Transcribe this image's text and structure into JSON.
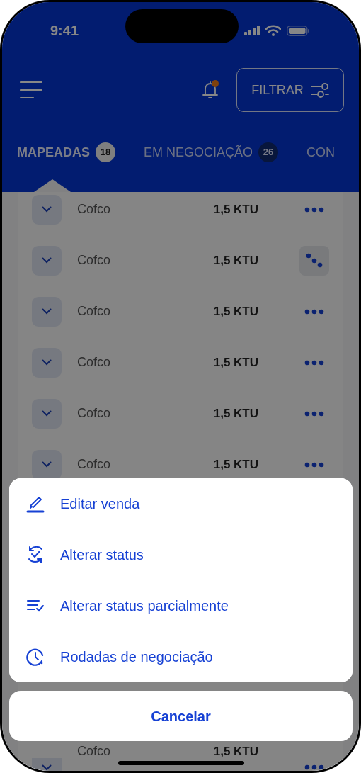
{
  "status_bar": {
    "time": "9:41"
  },
  "toolbar": {
    "notification_unread": true,
    "filter_button": "FILTRAR"
  },
  "tabs": [
    {
      "label": "MAPEADAS",
      "count": "18",
      "selected": true
    },
    {
      "label": "EM NEGOCIAÇÃO",
      "count": "26",
      "selected": false
    },
    {
      "label": "CON",
      "selected": false
    }
  ],
  "rows": [
    {
      "name": "Cofco",
      "amount": "1,5 KTU",
      "menu_open": false
    },
    {
      "name": "Cofco",
      "amount": "1,5 KTU",
      "menu_open": true
    },
    {
      "name": "Cofco",
      "amount": "1,5 KTU",
      "menu_open": false
    },
    {
      "name": "Cofco",
      "amount": "1,5 KTU",
      "menu_open": false
    },
    {
      "name": "Cofco",
      "amount": "1,5 KTU",
      "menu_open": false
    },
    {
      "name": "Cofco",
      "amount": "1,5 KTU",
      "menu_open": false
    },
    {
      "name": "Cofco",
      "amount": "1,5 KTU",
      "menu_open": false
    }
  ],
  "action_sheet": {
    "items": [
      {
        "kind": "edit",
        "label": "Editar venda"
      },
      {
        "kind": "status",
        "label": "Alterar status"
      },
      {
        "kind": "partial",
        "label": "Alterar status parcialmente"
      },
      {
        "kind": "history",
        "label": "Rodadas de negociação"
      }
    ],
    "cancel": "Cancelar"
  }
}
